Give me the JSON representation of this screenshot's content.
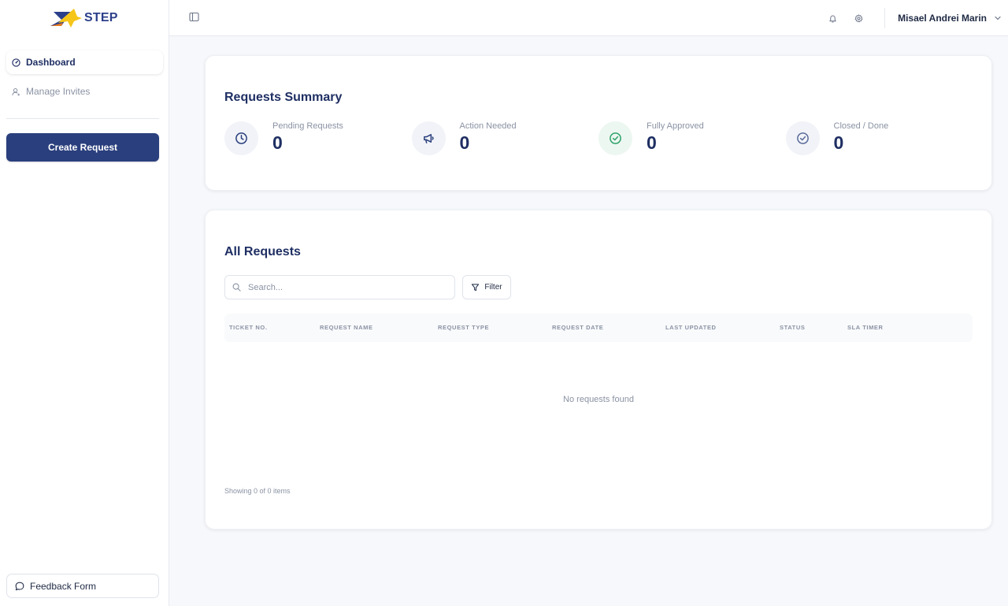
{
  "brand": {
    "name": "STEP",
    "colors": {
      "primary": "#2a3f7d",
      "accent": "#f5c518"
    }
  },
  "sidebar": {
    "items": [
      {
        "label": "Dashboard",
        "icon": "dashboard-icon",
        "active": true
      },
      {
        "label": "Manage Invites",
        "icon": "user-icon",
        "active": false
      }
    ],
    "create_label": "Create Request",
    "feedback_label": "Feedback Form"
  },
  "topbar": {
    "user_name": "Misael Andrei Marin",
    "icons": [
      "sidebar-toggle-icon",
      "bell-icon",
      "gear-icon",
      "chevron-down-icon"
    ]
  },
  "summary": {
    "title": "Requests Summary",
    "stats": [
      {
        "label": "Pending Requests",
        "value": "0",
        "icon": "clock-icon",
        "color": "#2a3f7d"
      },
      {
        "label": "Action Needed",
        "value": "0",
        "icon": "megaphone-icon",
        "color": "#2a3f7d"
      },
      {
        "label": "Fully Approved",
        "value": "0",
        "icon": "check-circle-icon",
        "color": "#2fa36b"
      },
      {
        "label": "Closed / Done",
        "value": "0",
        "icon": "check-circle-icon",
        "color": "#5b6b9a"
      }
    ]
  },
  "requests": {
    "title": "All Requests",
    "search_placeholder": "Search...",
    "filter_label": "Filter",
    "columns": [
      "TICKET NO.",
      "REQUEST NAME",
      "REQUEST TYPE",
      "REQUEST DATE",
      "LAST UPDATED",
      "STATUS",
      "SLA TIMER"
    ],
    "empty_message": "No requests found",
    "showing": "Showing 0 of 0 items"
  }
}
